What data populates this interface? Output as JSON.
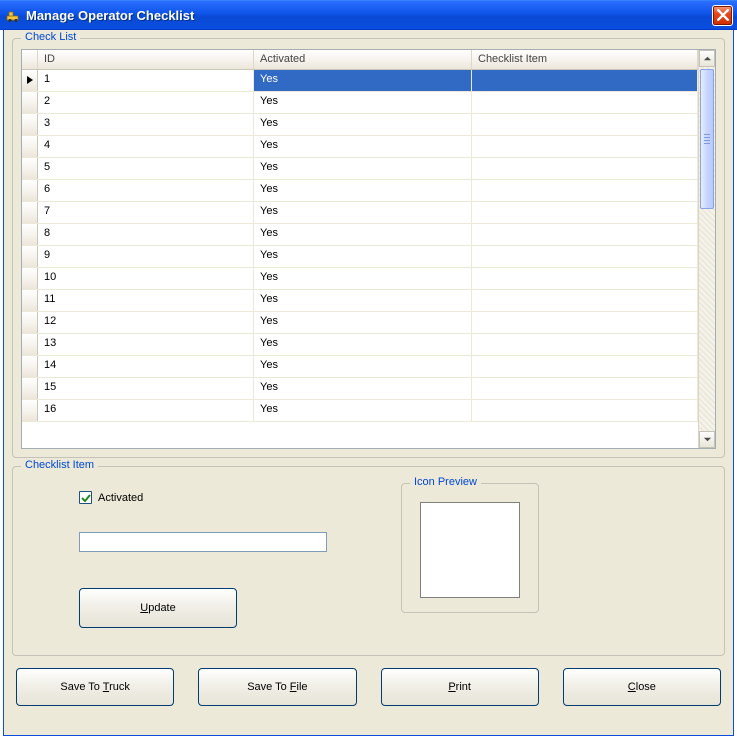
{
  "window": {
    "title": "Manage Operator Checklist"
  },
  "group": {
    "checklist_label": "Check List",
    "item_label": "Checklist Item",
    "icon_preview_label": "Icon Preview"
  },
  "grid": {
    "columns": {
      "id": "ID",
      "activated": "Activated",
      "item": "Checklist Item"
    },
    "selected_id": 1,
    "rows": [
      {
        "id": "1",
        "activated": "Yes",
        "item": ""
      },
      {
        "id": "2",
        "activated": "Yes",
        "item": ""
      },
      {
        "id": "3",
        "activated": "Yes",
        "item": ""
      },
      {
        "id": "4",
        "activated": "Yes",
        "item": ""
      },
      {
        "id": "5",
        "activated": "Yes",
        "item": ""
      },
      {
        "id": "6",
        "activated": "Yes",
        "item": ""
      },
      {
        "id": "7",
        "activated": "Yes",
        "item": ""
      },
      {
        "id": "8",
        "activated": "Yes",
        "item": ""
      },
      {
        "id": "9",
        "activated": "Yes",
        "item": ""
      },
      {
        "id": "10",
        "activated": "Yes",
        "item": ""
      },
      {
        "id": "11",
        "activated": "Yes",
        "item": ""
      },
      {
        "id": "12",
        "activated": "Yes",
        "item": ""
      },
      {
        "id": "13",
        "activated": "Yes",
        "item": ""
      },
      {
        "id": "14",
        "activated": "Yes",
        "item": ""
      },
      {
        "id": "15",
        "activated": "Yes",
        "item": ""
      },
      {
        "id": "16",
        "activated": "Yes",
        "item": ""
      }
    ]
  },
  "editor": {
    "activated_checked": true,
    "activated_label": "Activated",
    "item_text": "",
    "update_mnemonic": "U",
    "update_rest": "pdate"
  },
  "buttons": {
    "save_truck_pre": "Save To ",
    "save_truck_mn": "T",
    "save_truck_post": "ruck",
    "save_file_pre": "Save To ",
    "save_file_mn": "F",
    "save_file_post": "ile",
    "print_mn": "P",
    "print_rest": "rint",
    "close_mn": "C",
    "close_rest": "lose"
  },
  "colors": {
    "selection_bg": "#316ac5"
  }
}
